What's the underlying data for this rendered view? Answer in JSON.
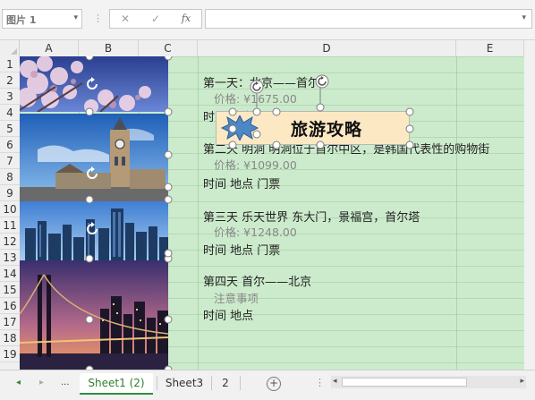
{
  "formula_bar": {
    "name_box": "图片 1",
    "name_dropdown": "▾",
    "separator": "⋮",
    "cancel": "✕",
    "confirm": "✓",
    "fx": "fx",
    "formula_dropdown": "▾"
  },
  "columns": [
    "A",
    "B",
    "C",
    "D",
    "E"
  ],
  "rows": [
    "1",
    "2",
    "3",
    "4",
    "5",
    "6",
    "7",
    "8",
    "9",
    "10",
    "11",
    "12",
    "13",
    "14",
    "15",
    "16",
    "17",
    "18",
    "19"
  ],
  "cells": {
    "d2": "第一天：北京——首尔",
    "d3": "价格: ¥1675.00",
    "d4": "时间 地点 门票",
    "d6": "第二天 明洞 明洞位于首尔中区，是韩国代表性的购物街",
    "d7": "价格: ¥1099.00",
    "d8": "时间 地点 门票",
    "d10": "第三天 乐天世界 东大门，景福宫，首尔塔",
    "d11": "价格: ¥1248.00",
    "d12": "时间 地点 门票",
    "d14": "第四天 首尔——北京",
    "d15": "注意事项",
    "d16": "时间 地点"
  },
  "textbox": {
    "title": "旅游攻略"
  },
  "sheet_tabs": {
    "prev": "◂",
    "next": "▸",
    "more": "...",
    "tabs": [
      "Sheet1 (2)",
      "Sheet3",
      "2"
    ],
    "active_index": 0,
    "add": "+",
    "options": "⋮"
  },
  "images": [
    "cherry-blossom-photo",
    "clock-tower-photo",
    "city-skyline-photo",
    "bridge-night-photo"
  ],
  "colors": {
    "grid_background": "#ccebcc",
    "textbox_fill": "#fde8c4",
    "active_tab_accent": "#2f8f3f"
  }
}
